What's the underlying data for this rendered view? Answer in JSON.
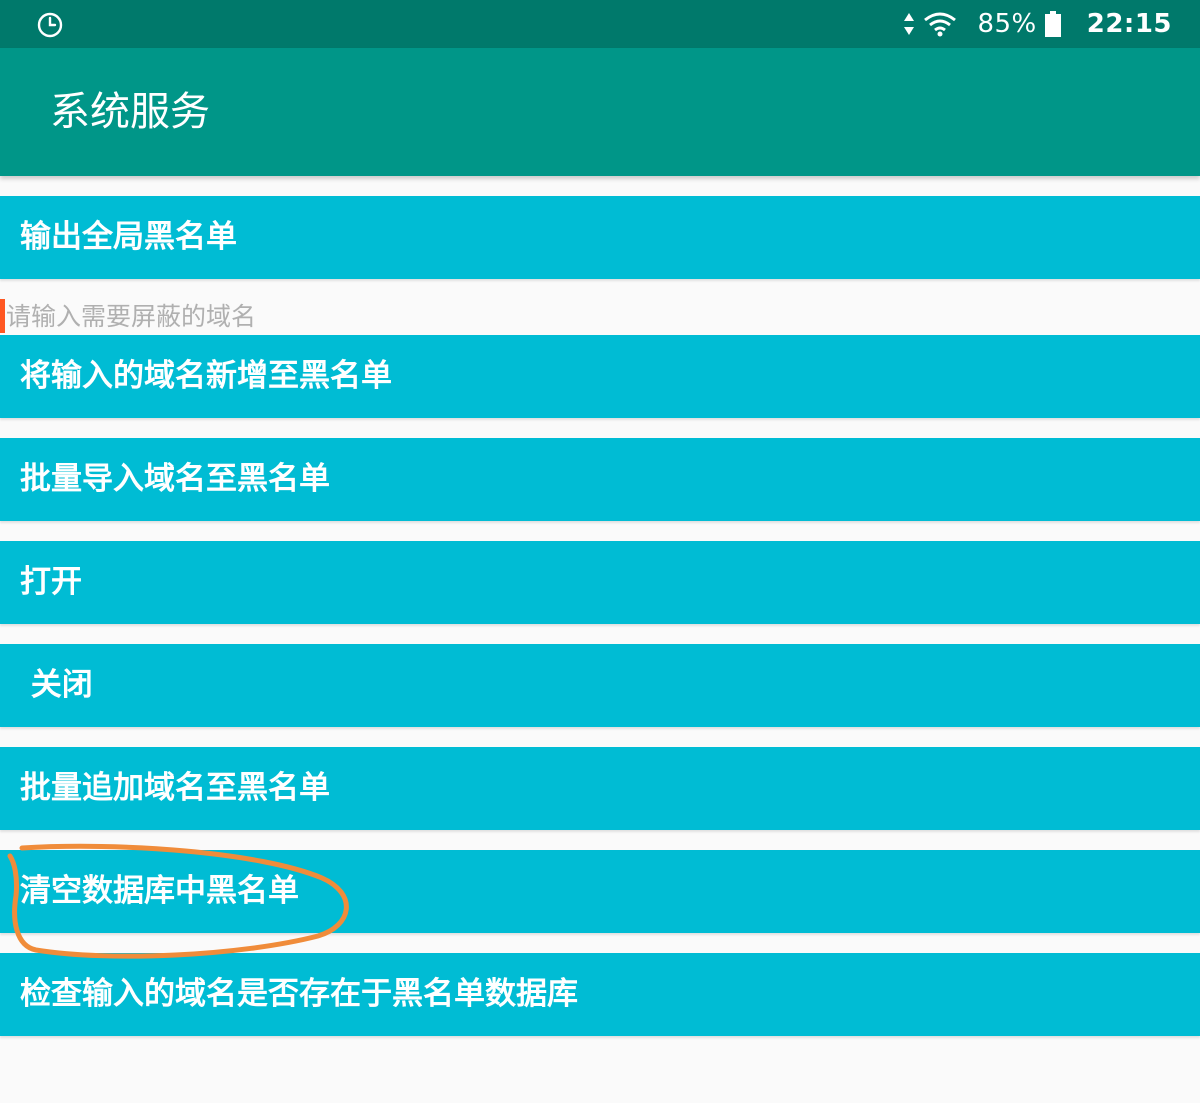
{
  "status_bar": {
    "icons": [
      "clock-icon",
      "data-arrows-icon",
      "wifi-icon",
      "battery-icon"
    ],
    "battery": "85%",
    "time": "22:15"
  },
  "app_bar": {
    "title": "系统服务",
    "color": "#009688"
  },
  "buttons": {
    "export_blacklist": "输出全局黑名单",
    "add_domain": "将输入的域名新增至黑名单",
    "batch_import": "批量导入域名至黑名单",
    "open": "打开",
    "close": " 关闭",
    "batch_append": "批量追加域名至黑名单",
    "clear_database": "清空数据库中黑名单",
    "check_domain": "检查输入的域名是否存在于黑名单数据库"
  },
  "domain_input": {
    "value": "",
    "placeholder": "请输入需要屏蔽的域名"
  },
  "colors": {
    "status_bar": "#00796b",
    "button": "#00bcd4",
    "annotation": "#f08c3a"
  }
}
